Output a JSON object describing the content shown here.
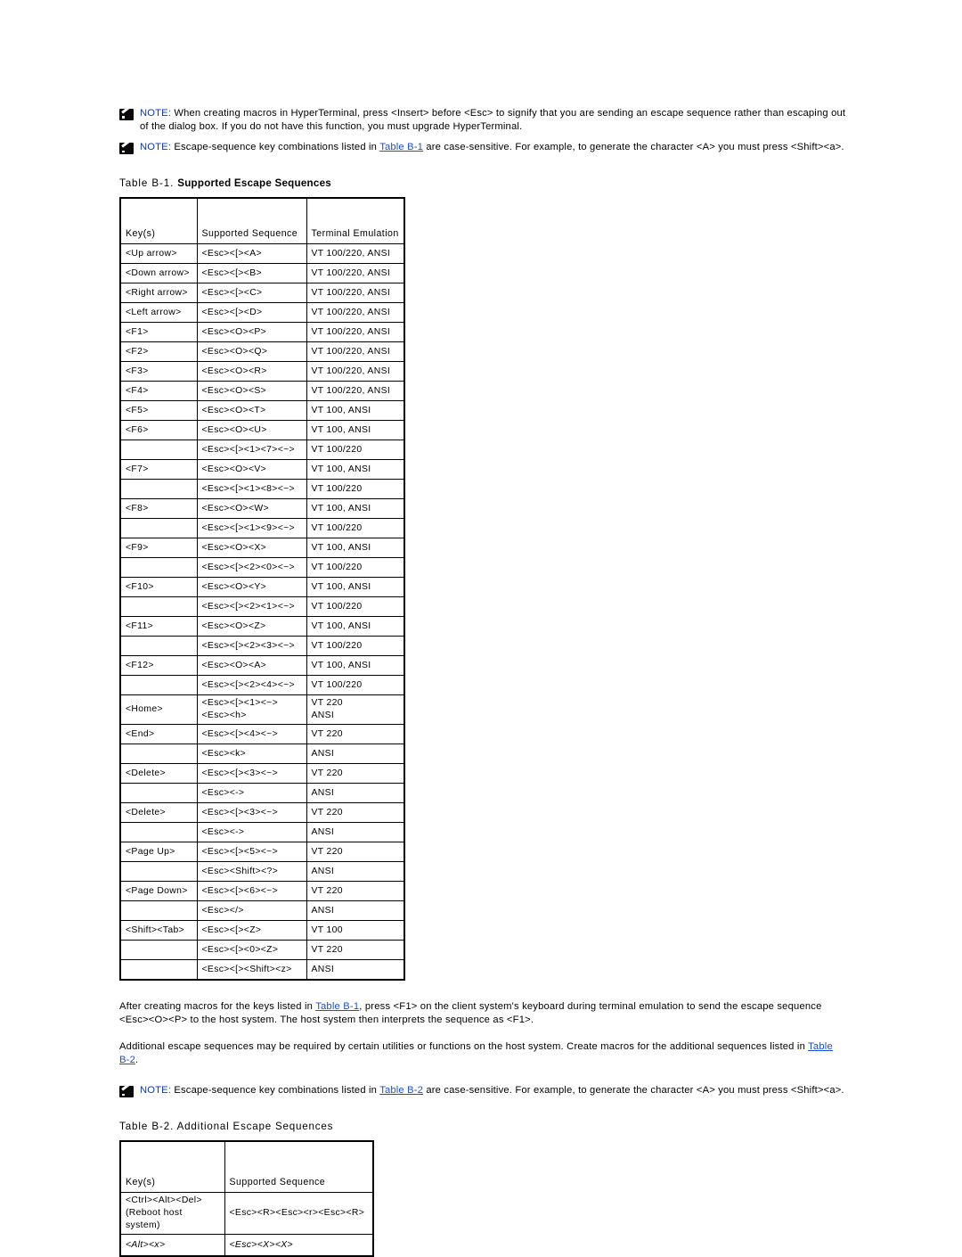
{
  "notes": [
    {
      "label": "NOTE:",
      "text_before": " When creating macros in HyperTerminal, press <Insert> before <Esc> to signify that you are sending an escape sequence rather than escaping out of the dialog box. If you do not have this function, you must upgrade HyperTerminal.",
      "link": "",
      "text_after": ""
    },
    {
      "label": "NOTE:",
      "text_before": " Escape-sequence key combinations listed in ",
      "link": "Table B-1",
      "text_after": " are case-sensitive. For example, to generate the character <A> you must press <Shift><a>."
    },
    {
      "label": "NOTE:",
      "text_before": " Escape-sequence key combinations listed in ",
      "link": "Table B-2",
      "text_after": " are case-sensitive. For example, to generate the character <A> you must press <Shift><a>."
    }
  ],
  "table_b1": {
    "caption_number": "Table B-1.",
    "caption_title": "Supported Escape Sequences",
    "headers": [
      "Key(s)",
      "Supported Sequence",
      "Terminal Emulation"
    ],
    "rows": [
      {
        "key": "<Up arrow>",
        "sequence": "<Esc><[><A>",
        "emulation": "VT 100/220, ANSI"
      },
      {
        "key": "<Down arrow>",
        "sequence": "<Esc><[><B>",
        "emulation": "VT 100/220, ANSI"
      },
      {
        "key": "<Right arrow>",
        "sequence": "<Esc><[><C>",
        "emulation": "VT 100/220, ANSI"
      },
      {
        "key": "<Left arrow>",
        "sequence": "<Esc><[><D>",
        "emulation": "VT 100/220, ANSI"
      },
      {
        "key": "<F1>",
        "sequence": "<Esc><O><P>",
        "emulation": "VT 100/220, ANSI"
      },
      {
        "key": "<F2>",
        "sequence": "<Esc><O><Q>",
        "emulation": "VT 100/220, ANSI"
      },
      {
        "key": "<F3>",
        "sequence": "<Esc><O><R>",
        "emulation": "VT 100/220, ANSI"
      },
      {
        "key": "<F4>",
        "sequence": "<Esc><O><S>",
        "emulation": "VT 100/220, ANSI"
      },
      {
        "key": "<F5>",
        "sequence": "<Esc><O><T>",
        "emulation": "VT 100, ANSI"
      },
      {
        "key": "<F6>",
        "sequence": "<Esc><O><U>",
        "emulation": "VT 100, ANSI"
      },
      {
        "key": "",
        "sequence": "<Esc><[><1><7><~>",
        "emulation": "VT 100/220"
      },
      {
        "key": "<F7>",
        "sequence": "<Esc><O><V>",
        "emulation": "VT 100, ANSI"
      },
      {
        "key": "",
        "sequence": "<Esc><[><1><8><~>",
        "emulation": "VT 100/220"
      },
      {
        "key": "<F8>",
        "sequence": "<Esc><O><W>",
        "emulation": "VT 100, ANSI"
      },
      {
        "key": "",
        "sequence": "<Esc><[><1><9><~>",
        "emulation": "VT 100/220"
      },
      {
        "key": "<F9>",
        "sequence": "<Esc><O><X>",
        "emulation": "VT 100, ANSI"
      },
      {
        "key": "",
        "sequence": "<Esc><[><2><0><~>",
        "emulation": "VT 100/220"
      },
      {
        "key": "<F10>",
        "sequence": "<Esc><O><Y>",
        "emulation": "VT 100, ANSI"
      },
      {
        "key": "",
        "sequence": "<Esc><[><2><1><~>",
        "emulation": "VT 100/220"
      },
      {
        "key": "<F11>",
        "sequence": "<Esc><O><Z>",
        "emulation": "VT 100, ANSI"
      },
      {
        "key": "",
        "sequence": "<Esc><[><2><3><~>",
        "emulation": "VT 100/220"
      },
      {
        "key": "<F12>",
        "sequence": "<Esc><O><A>",
        "emulation": "VT 100, ANSI"
      },
      {
        "key": "",
        "sequence": "<Esc><[><2><4><~>",
        "emulation": "VT 100/220"
      },
      {
        "key": "<Home>",
        "sequence": "<Esc><[><1><~>\n<Esc><h>",
        "emulation": "VT 220\nANSI",
        "multiline": true
      },
      {
        "key": "<End>",
        "sequence": "<Esc><[><4><~>",
        "emulation": "VT 220"
      },
      {
        "key": "",
        "sequence": "<Esc><k>",
        "emulation": "ANSI"
      },
      {
        "key": "<Delete>",
        "sequence": "<Esc><[><3><~>",
        "emulation": "VT 220"
      },
      {
        "key": "",
        "sequence": "<Esc><->",
        "emulation": "ANSI"
      },
      {
        "key": "<Delete>",
        "sequence": "<Esc><[><3><~>",
        "emulation": "VT 220"
      },
      {
        "key": "",
        "sequence": "<Esc><->",
        "emulation": "ANSI"
      },
      {
        "key": "<Page Up>",
        "sequence": "<Esc><[><5><~>",
        "emulation": "VT 220"
      },
      {
        "key": "",
        "sequence": "<Esc><Shift><?>",
        "emulation": "ANSI"
      },
      {
        "key": "<Page Down>",
        "sequence": "<Esc><[><6><~>",
        "emulation": "VT 220"
      },
      {
        "key": "",
        "sequence": "<Esc></>",
        "emulation": "ANSI"
      },
      {
        "key": "<Shift><Tab>",
        "sequence": "<Esc><[><Z>",
        "emulation": "VT 100"
      },
      {
        "key": "",
        "sequence": "<Esc><[><0><Z>",
        "emulation": "VT 220"
      },
      {
        "key": "",
        "sequence": "<Esc><[><Shift><z>",
        "emulation": "ANSI"
      }
    ]
  },
  "paragraphs": {
    "after_table_b1": {
      "text_1": "After creating macros for the keys listed in ",
      "link": "Table B-1",
      "text_2": ", press <F1> on the client system's keyboard during terminal emulation to send the escape sequence <Esc><O><P> to the host system. The host system then interprets the sequence as <F1>."
    },
    "additional": {
      "text_1": "Additional escape sequences may be required by certain utilities or functions on the host system. Create macros for the additional sequences listed in ",
      "link": "Table B-2",
      "text_2": "."
    }
  },
  "table_b2": {
    "caption_number": "Table B-2.",
    "caption_title": "Additional Escape Sequences",
    "headers": [
      "Key(s)",
      "Supported Sequence"
    ],
    "rows": [
      {
        "key": "<Ctrl><Alt><Del>\n(Reboot host system)",
        "sequence": "<Esc><R><Esc><r><Esc><R>",
        "multiline": true
      },
      {
        "key": "<Alt><x>",
        "sequence": "<Esc><X><X>",
        "italic": true
      }
    ]
  }
}
